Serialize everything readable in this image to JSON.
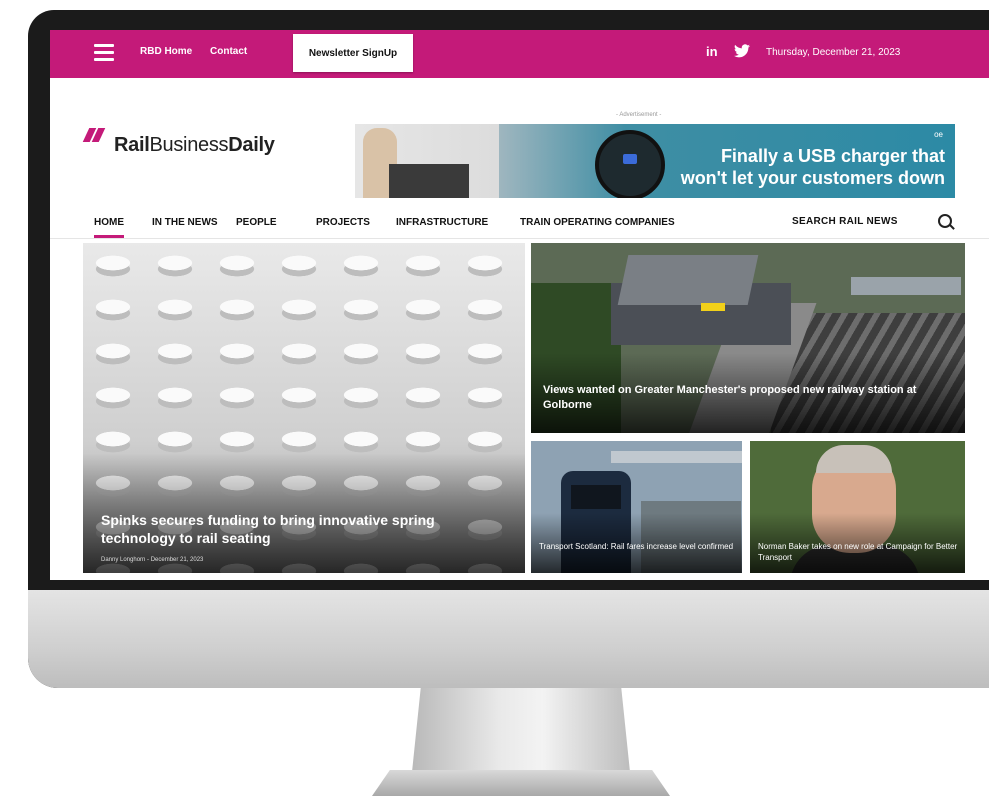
{
  "topbar": {
    "links": [
      "RBD Home",
      "Contact"
    ],
    "newsletter_button": "Newsletter SignUp",
    "social": {
      "linkedin": "in",
      "twitter": "twitter-icon"
    },
    "date": "Thursday, December 21, 2023"
  },
  "header": {
    "logo_part1": "Rail",
    "logo_part2": "Business",
    "logo_part3": "Daily",
    "ad_label": "- Advertisement -",
    "ad_line1": "Finally a USB charger that",
    "ad_line2": "won't let your customers down",
    "ad_logos": "oe"
  },
  "nav": {
    "items": [
      "HOME",
      "IN THE NEWS",
      "PEOPLE",
      "PROJECTS",
      "INFRASTRUCTURE",
      "TRAIN OPERATING COMPANIES"
    ],
    "search_label": "SEARCH RAIL NEWS"
  },
  "articles": {
    "feature": {
      "title": "Spinks secures funding to bring innovative spring technology to rail seating",
      "meta": "Danny Longhorn - December 21, 2023"
    },
    "second": {
      "title": "Views wanted on Greater Manchester's proposed new railway station at Golborne"
    },
    "third": {
      "title": "Transport Scotland: Rail fares increase level confirmed"
    },
    "fourth": {
      "title": "Norman Baker takes on new role at Campaign for Better Transport"
    }
  },
  "colors": {
    "brand": "#c41a79",
    "ad_bg": "#2c8aa5"
  }
}
